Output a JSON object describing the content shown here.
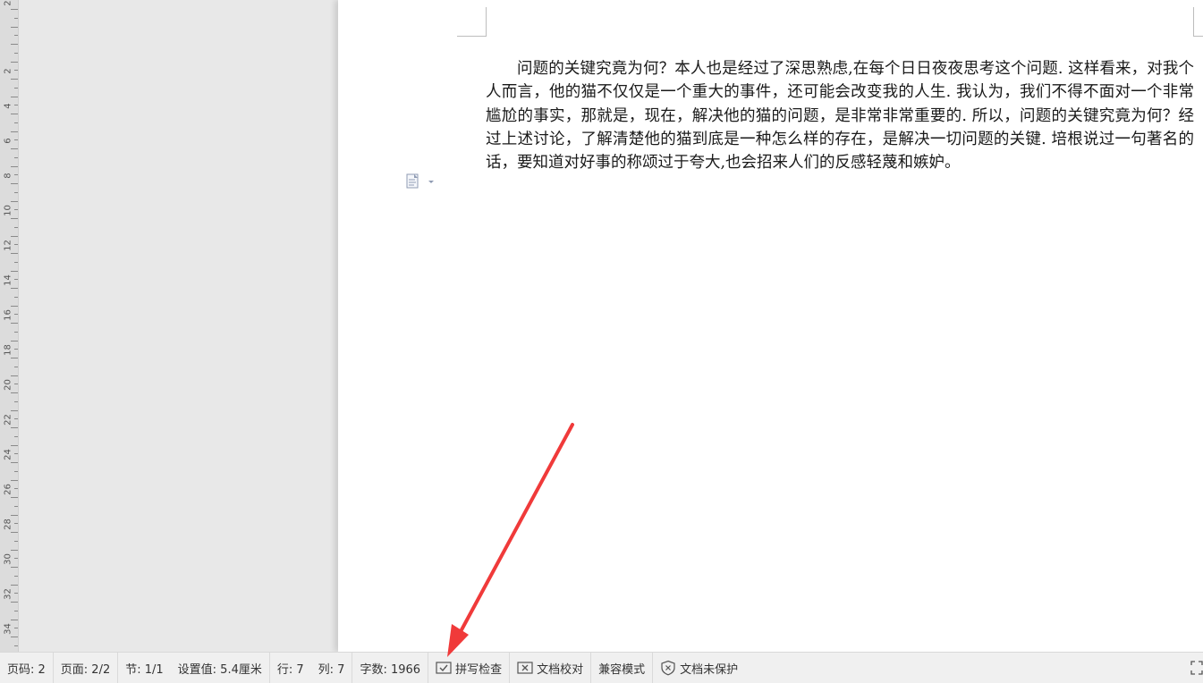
{
  "ruler": {
    "numbers": [
      "2",
      "2",
      "4",
      "6",
      "8",
      "10",
      "12",
      "14",
      "16",
      "18",
      "20",
      "22",
      "24",
      "26",
      "28",
      "30",
      "32",
      "34"
    ]
  },
  "document": {
    "paragraph": "问题的关键究竟为何？本人也是经过了深思熟虑,在每个日日夜夜思考这个问题. 这样看来，对我个人而言，他的猫不仅仅是一个重大的事件，还可能会改变我的人生. 我认为，我们不得不面对一个非常尴尬的事实，那就是，现在，解决他的猫的问题，是非常非常重要的. 所以，问题的关键究竟为何？经过上述讨论，了解清楚他的猫到底是一种怎么样的存在，是解决一切问题的关键. 培根说过一句著名的话，要知道对好事的称颂过于夸大,也会招来人们的反感轻蔑和嫉妒。"
  },
  "statusbar": {
    "page_code": "页码: 2",
    "pages": "页面: 2/2",
    "section": "节: 1/1",
    "setting": "设置值: 5.4厘米",
    "row": "行: 7",
    "col": "列: 7",
    "word_count": "字数: 1966",
    "spell_check": "拼写检查",
    "doc_proof": "文档校对",
    "compat_mode": "兼容模式",
    "unprotected": "文档未保护"
  },
  "icons": {
    "spell_check": "spell-check-icon",
    "doc_proof": "doc-proof-icon",
    "unprotected": "shield-x-icon",
    "fullscreen": "fullscreen-icon",
    "paragraph_options": "paragraph-options-icon"
  },
  "colors": {
    "annotation_arrow": "#f03a3a",
    "page": "#ffffff",
    "canvas": "#e8e8e8",
    "statusbar": "#f0f0f0"
  }
}
